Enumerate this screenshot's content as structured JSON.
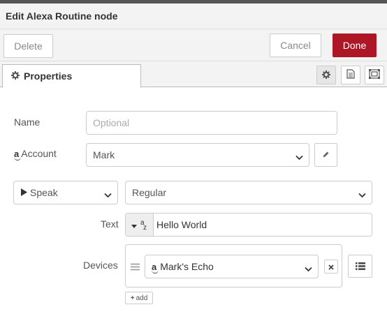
{
  "header": {
    "title": "Edit Alexa Routine node"
  },
  "actions": {
    "delete_label": "Delete",
    "cancel_label": "Cancel",
    "done_label": "Done",
    "done_color": "#ad1625"
  },
  "tabs": {
    "properties_label": "Properties",
    "icons": [
      "gear-icon",
      "document-icon",
      "frame-icon"
    ]
  },
  "form": {
    "name_label": "Name",
    "name_placeholder": "Optional",
    "name_value": "",
    "account_label": "Account",
    "account_value": "Mark",
    "action_value": "Speak",
    "speak_type_value": "Regular",
    "text_label": "Text",
    "text_type_glyph": "a z",
    "text_value": "Hello World",
    "devices_label": "Devices",
    "device_value": "Mark's Echo",
    "add_label": "add"
  }
}
